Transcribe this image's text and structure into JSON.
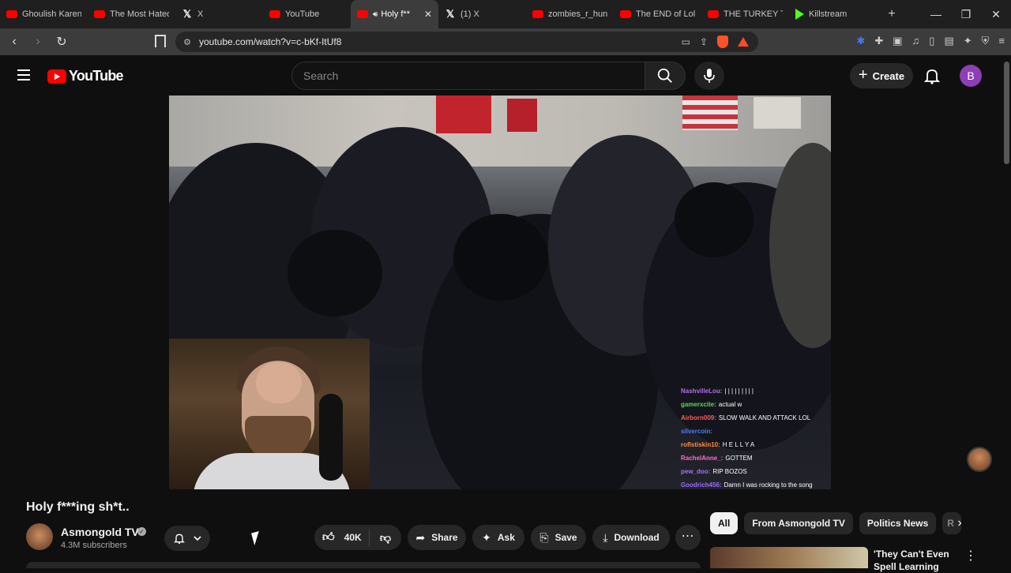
{
  "browser": {
    "tabs": [
      {
        "label": "Ghoulish Karen",
        "icon": "youtube-icon"
      },
      {
        "label": "The Most Hated",
        "icon": "youtube-icon"
      },
      {
        "label": "X",
        "icon": "x-icon"
      },
      {
        "label": "YouTube",
        "icon": "youtube-icon"
      },
      {
        "label": "Holy f**",
        "icon": "youtube-icon",
        "active": true
      },
      {
        "label": "(1) X",
        "icon": "x-icon"
      },
      {
        "label": "zombies_r_hung",
        "icon": "youtube-icon"
      },
      {
        "label": "The END of Lol",
        "icon": "youtube-icon"
      },
      {
        "label": "THE TURKEY TC",
        "icon": "youtube-icon"
      },
      {
        "label": "Killstream",
        "icon": "kick-icon"
      }
    ],
    "url": "youtube.com/watch?v=c-bKf-ItUf8"
  },
  "youtube": {
    "logo_text": "YouTube",
    "search_placeholder": "Search",
    "create_label": "Create",
    "avatar_letter": "B"
  },
  "video": {
    "title": "Holy f***ing sh*t..",
    "channel": "Asmongold TV",
    "subscribers": "4.3M subscribers",
    "likes": "40K",
    "share_label": "Share",
    "ask_label": "Ask",
    "save_label": "Save",
    "download_label": "Download"
  },
  "chat": [
    {
      "name": "NashvilleLou:",
      "msg": "| | | | | | | | |",
      "color": "#b16ee8"
    },
    {
      "name": "gamerxcite:",
      "msg": "actual w",
      "color": "#5fd35f"
    },
    {
      "name": "Airborn009:",
      "msg": "SLOW WALK AND ATTACK LOL",
      "color": "#ff5a5a"
    },
    {
      "name": "silvercoin:",
      "msg": "",
      "color": "#4f7cff"
    },
    {
      "name": "roflstiskin10:",
      "msg": "H E L L Y A",
      "color": "#ff8c3a"
    },
    {
      "name": "RachelAnne_:",
      "msg": "GOTTEM",
      "color": "#ff6ec7"
    },
    {
      "name": "pew_doo:",
      "msg": "RIP BOZOS",
      "color": "#a56eff"
    },
    {
      "name": "Goodrich456:",
      "msg": "Damn I was rocking to the song",
      "color": "#9a6cff"
    }
  ],
  "chips": [
    {
      "label": "All",
      "active": true
    },
    {
      "label": "From Asmongold TV"
    },
    {
      "label": "Politics News"
    },
    {
      "label": "R"
    }
  ],
  "recommendation": {
    "title": "'They Can't Even Spell Learning"
  }
}
